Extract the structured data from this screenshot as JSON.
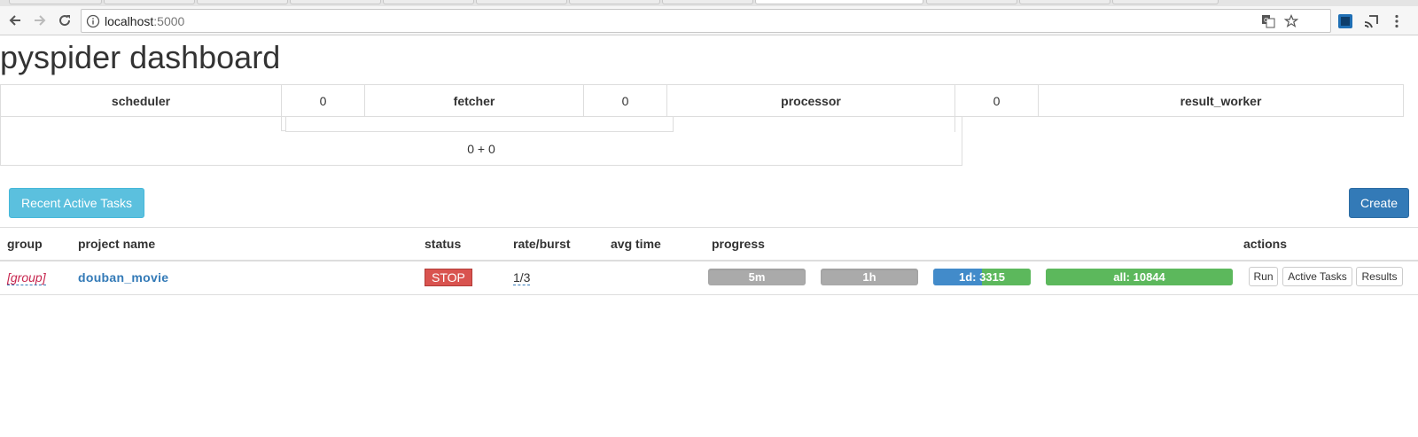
{
  "browser": {
    "url_host": "localhost",
    "url_port": ":5000"
  },
  "page": {
    "title": "pyspider dashboard"
  },
  "queues": {
    "scheduler_label": "scheduler",
    "scheduler_to_fetcher": "0",
    "fetcher_label": "fetcher",
    "fetcher_to_processor": "0",
    "processor_label": "processor",
    "processor_to_result": "0",
    "result_worker_label": "result_worker",
    "total": "0 + 0"
  },
  "buttons": {
    "recent_active_tasks": "Recent Active Tasks",
    "create": "Create"
  },
  "projects_table": {
    "headers": {
      "group": "group",
      "project_name": "project name",
      "status": "status",
      "rate_burst": "rate/burst",
      "avg_time": "avg time",
      "progress": "progress",
      "actions": "actions"
    },
    "rows": [
      {
        "group": "[group]",
        "name": "douban_movie",
        "status": "STOP",
        "rate_burst": "1/3",
        "avg_time": "",
        "progress": {
          "p5m": {
            "label": "5m"
          },
          "p1h": {
            "label": "1h"
          },
          "p1d": {
            "label": "1d: 3315",
            "pending_fraction": 0.5,
            "success_fraction": 0.5
          },
          "all": {
            "label": "all: 10844",
            "success_fraction": 1.0
          }
        },
        "actions": {
          "run": "Run",
          "active_tasks": "Active Tasks",
          "results": "Results"
        }
      }
    ]
  },
  "colors": {
    "status_stop": "#d9534f",
    "progress_pending": "#428bca",
    "progress_success": "#5cb85c",
    "progress_empty": "#aaaaaa",
    "group_text": "#c7254e",
    "link": "#337ab7"
  },
  "icons": [
    "back-arrow-icon",
    "forward-arrow-icon",
    "reload-icon",
    "info-icon",
    "translate-icon",
    "star-icon",
    "extension-icon",
    "cast-icon",
    "menu-dots-icon"
  ]
}
